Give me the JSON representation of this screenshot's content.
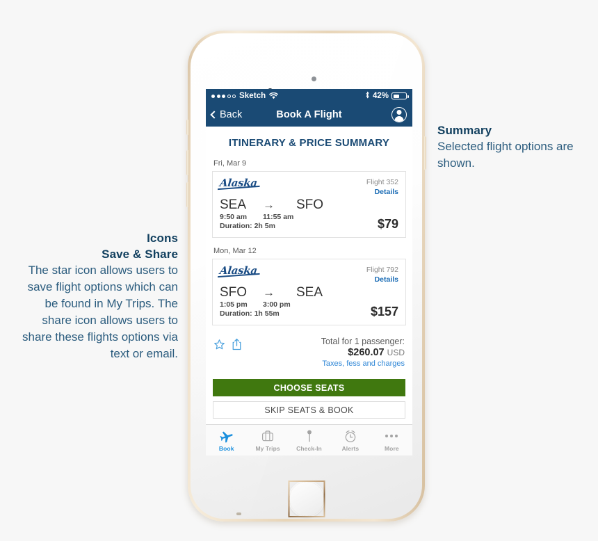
{
  "annotations": [
    {
      "id": "summary",
      "title": "Summary",
      "body": "Selected flight options are shown."
    },
    {
      "id": "icons",
      "title_line1": "Icons",
      "title_line2": "Save & Share",
      "body": "The star icon allows users to save flight options which can be found in My Trips. The share icon allows users to share these flights options via text or email."
    }
  ],
  "phone": {
    "hardware": {
      "camera": "front-camera",
      "speaker": "earpiece-speaker",
      "sensor": "proximity-sensor",
      "home_button": "home-button"
    }
  },
  "status_bar": {
    "signal_filled": 3,
    "signal_total": 5,
    "carrier": "Sketch",
    "wifi": "wifi-icon",
    "bluetooth": "bluetooth-icon",
    "battery_percent": "42%",
    "battery_level": 42
  },
  "nav_bar": {
    "back_label": "Back",
    "title": "Book A Flight",
    "profile": "profile-icon"
  },
  "main": {
    "heading": "ITINERARY & PRICE SUMMARY",
    "legs": [
      {
        "date": "Fri, Mar 9",
        "airline": "Alaska",
        "flight_number": "Flight 352",
        "details_label": "Details",
        "origin": "SEA",
        "arrow": "→",
        "destination": "SFO",
        "depart_time": "9:50 am",
        "arrive_time": "11:55 am",
        "duration": "Duration: 2h 5m",
        "price": "$79"
      },
      {
        "date": "Mon, Mar 12",
        "airline": "Alaska",
        "flight_number": "Flight 792",
        "details_label": "Details",
        "origin": "SFO",
        "arrow": "→",
        "destination": "SEA",
        "depart_time": "1:05 pm",
        "arrive_time": "3:00 pm",
        "duration": "Duration: 1h 55m",
        "price": "$157"
      }
    ],
    "totals": {
      "label": "Total for 1 passenger:",
      "amount": "$260.07",
      "currency": "USD",
      "taxes_link": "Taxes, fess and charges",
      "save_icon": "star-icon",
      "share_icon": "share-icon"
    },
    "buttons": {
      "primary": "CHOOSE SEATS",
      "secondary": "SKIP SEATS & BOOK"
    }
  },
  "tab_bar": {
    "items": [
      {
        "label": "Book",
        "icon": "airplane-icon",
        "active": true
      },
      {
        "label": "My Trips",
        "icon": "suitcase-icon",
        "active": false
      },
      {
        "label": "Check-In",
        "icon": "pin-icon",
        "active": false
      },
      {
        "label": "Alerts",
        "icon": "alarm-clock-icon",
        "active": false
      },
      {
        "label": "More",
        "icon": "ellipsis-icon",
        "active": false
      }
    ]
  },
  "colors": {
    "navy": "#1a4a74",
    "alaska_blue": "#1b4d85",
    "green_cta": "#40780f",
    "link_blue": "#2e86d6",
    "tab_active": "#1a8fdd",
    "annotation": "#2b5c7e",
    "page_bg": "#f7f7f7"
  }
}
